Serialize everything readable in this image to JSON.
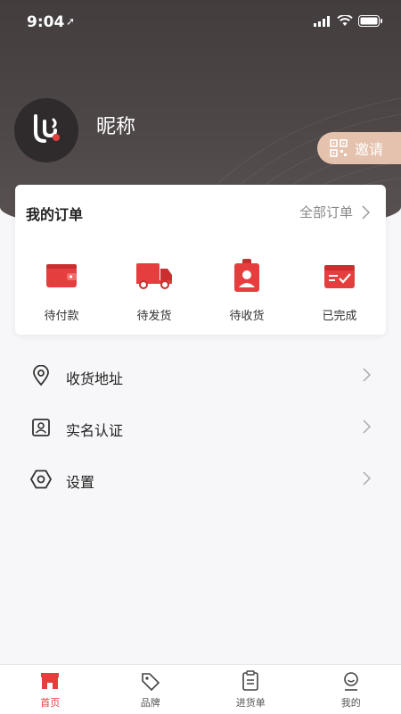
{
  "status_bar": {
    "time": "9:04"
  },
  "profile": {
    "nickname": "昵称",
    "invite_label": "邀请"
  },
  "orders": {
    "title": "我的订单",
    "all_label": "全部订单",
    "items": [
      {
        "label": "待付款",
        "icon": "wallet-icon"
      },
      {
        "label": "待发货",
        "icon": "truck-icon"
      },
      {
        "label": "待收货",
        "icon": "badge-person-icon"
      },
      {
        "label": "已完成",
        "icon": "box-check-icon"
      }
    ]
  },
  "menu": {
    "items": [
      {
        "label": "收货地址",
        "icon": "location-pin-icon"
      },
      {
        "label": "实名认证",
        "icon": "id-card-icon"
      },
      {
        "label": "设置",
        "icon": "hexagon-settings-icon"
      }
    ]
  },
  "tabbar": {
    "items": [
      {
        "label": "首页",
        "icon": "store-icon",
        "active": true
      },
      {
        "label": "品牌",
        "icon": "tag-icon",
        "active": false
      },
      {
        "label": "进货单",
        "icon": "clipboard-icon",
        "active": false
      },
      {
        "label": "我的",
        "icon": "user-icon",
        "active": false
      }
    ]
  },
  "colors": {
    "accent": "#e53e3e",
    "header": "#4a4344",
    "invite_bg": "#e4c2ad"
  }
}
